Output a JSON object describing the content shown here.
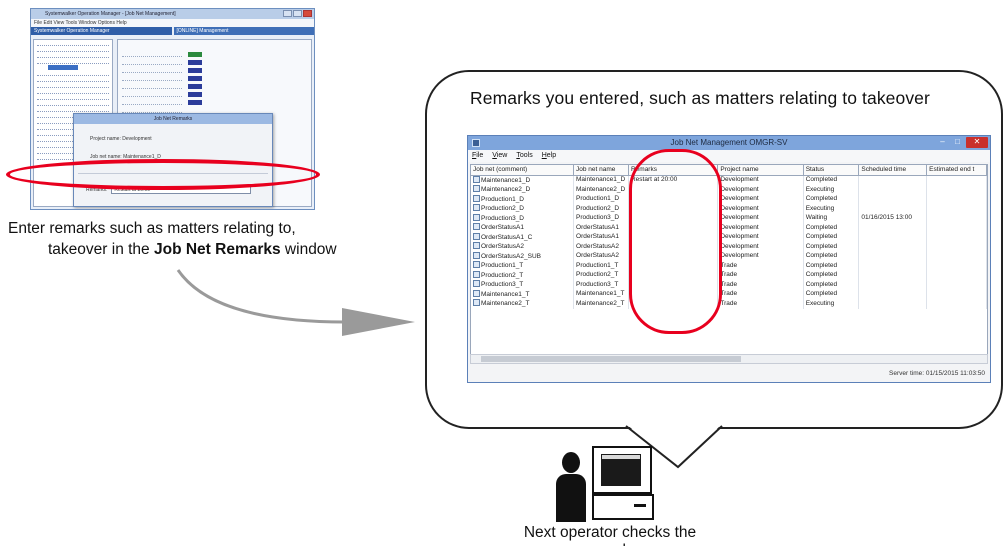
{
  "mini_window": {
    "title": "Systemwalker Operation Manager - [Job Net Management]",
    "menu": "File  Edit  View  Tools  Window  Options  Help",
    "tabs": [
      "Systemwalker Operation Manager",
      "[ONLINE] Management"
    ],
    "dialog_title": "Job Net Remarks",
    "dialog_line1": "Project name:  Development",
    "dialog_line2": "Job net name:  Maintenance1_D",
    "remarks_label": "Remarks:",
    "remarks_value": "Restart at 20:00"
  },
  "caption_left": {
    "line1": "Enter remarks such as matters relating to,",
    "line2_prefix": "takeover in the ",
    "line2_bold": "Job Net Remarks",
    "line2_suffix": " window"
  },
  "bubble_title": "Remarks you entered, such as matters relating to takeover",
  "window": {
    "title": "Job Net Management OMGR-SV",
    "menu": [
      "File",
      "View",
      "Tools",
      "Help"
    ],
    "columns": [
      "Job net (comment)",
      "Job net name",
      "Remarks",
      "Project name",
      "Status",
      "Scheduled time",
      "Estimated end t"
    ],
    "rows": [
      [
        "Maintenance1_D",
        "Maintenance1_D",
        "Restart at 20:00",
        "Development",
        "Completed",
        "",
        ""
      ],
      [
        "Maintenance2_D",
        "Maintenance2_D",
        "",
        "Development",
        "Executing",
        "",
        ""
      ],
      [
        "Production1_D",
        "Production1_D",
        "",
        "Development",
        "Completed",
        "",
        ""
      ],
      [
        "Production2_D",
        "Production2_D",
        "",
        "Development",
        "Executing",
        "",
        ""
      ],
      [
        "Production3_D",
        "Production3_D",
        "",
        "Development",
        "Waiting",
        "01/16/2015 13:00",
        ""
      ],
      [
        "OrderStatusA1",
        "OrderStatusA1",
        "",
        "Development",
        "Completed",
        "",
        ""
      ],
      [
        "OrderStatusA1_C",
        "OrderStatusA1",
        "",
        "Development",
        "Completed",
        "",
        ""
      ],
      [
        "OrderStatusA2",
        "OrderStatusA2",
        "",
        "Development",
        "Completed",
        "",
        ""
      ],
      [
        "OrderStatusA2_SUB",
        "OrderStatusA2",
        "",
        "Development",
        "Completed",
        "",
        ""
      ],
      [
        "Production1_T",
        "Production1_T",
        "",
        "Trade",
        "Completed",
        "",
        ""
      ],
      [
        "Production2_T",
        "Production2_T",
        "",
        "Trade",
        "Completed",
        "",
        ""
      ],
      [
        "Production3_T",
        "Production3_T",
        "",
        "Trade",
        "Completed",
        "",
        ""
      ],
      [
        "Maintenance1_T",
        "Maintenance1_T",
        "",
        "Trade",
        "Completed",
        "",
        ""
      ],
      [
        "Maintenance2_T",
        "Maintenance2_T",
        "",
        "Trade",
        "Executing",
        "",
        ""
      ]
    ],
    "status": "Server time: 01/15/2015 11:03:50"
  },
  "caption_bottom": "Next operator checks the remarks",
  "colors": {
    "highlight": "#e8001e",
    "titlebar": "#7ea5dc"
  }
}
